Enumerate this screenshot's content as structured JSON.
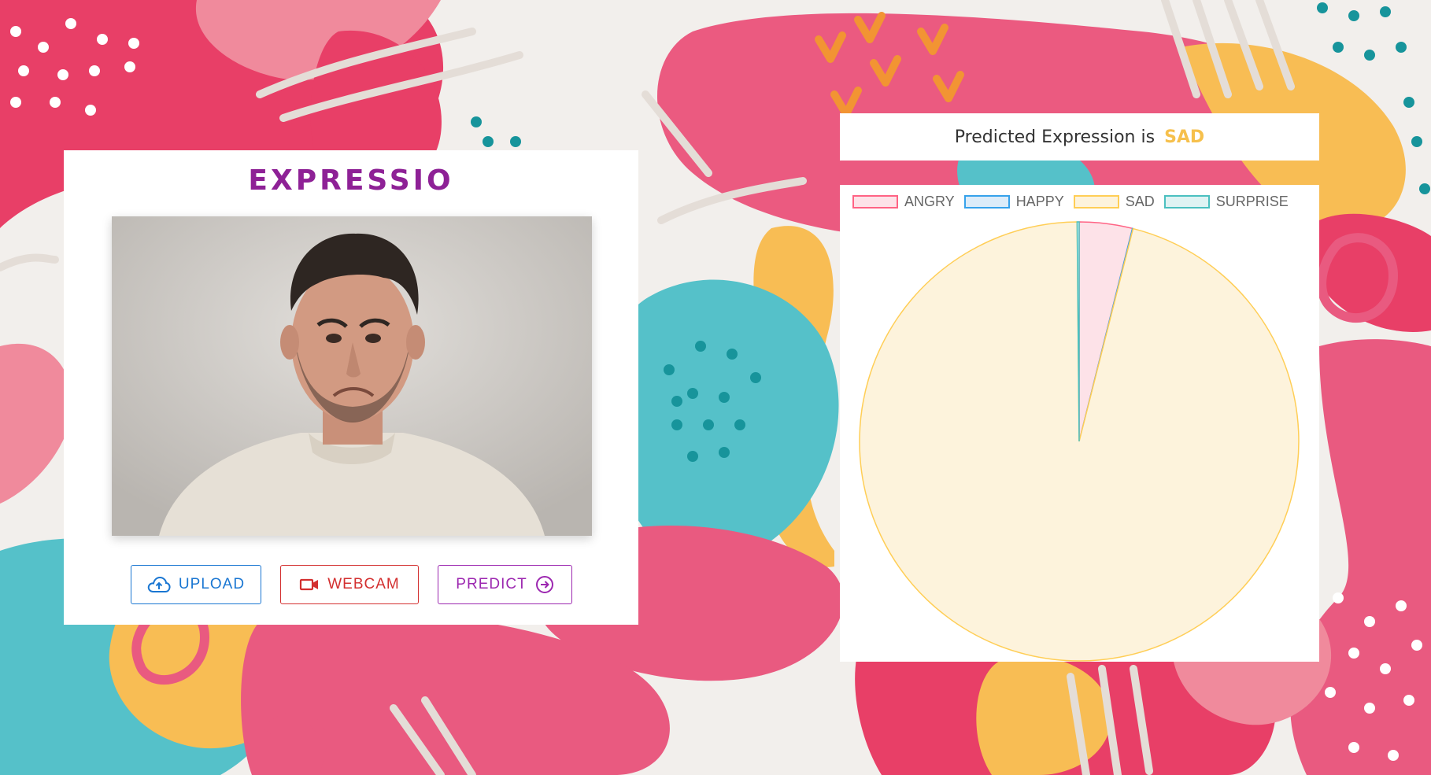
{
  "app": {
    "title": "EXPRESSIO"
  },
  "buttons": {
    "upload": {
      "label": "UPLOAD",
      "icon": "cloud-upload-icon"
    },
    "webcam": {
      "label": "WEBCAM",
      "icon": "videocam-icon"
    },
    "predict": {
      "label": "PREDICT",
      "icon": "arrow-circle-right-icon"
    }
  },
  "prediction": {
    "prefix": "Predicted Expression is",
    "value": "SAD"
  },
  "photo": {
    "subject": "sad-man-portrait"
  },
  "colors": {
    "title": "#8e2196",
    "upload": "#1976d2",
    "webcam": "#d32f2f",
    "predict": "#9c27b0",
    "prediction_value": "#f6c04c"
  },
  "chart_data": {
    "type": "pie",
    "legend_position": "top",
    "labels": [
      "ANGRY",
      "HAPPY",
      "SAD",
      "SURPRISE"
    ],
    "values": [
      3.9,
      0.05,
      95.9,
      0.15
    ],
    "background_colors": [
      "#fde2e8",
      "#dcecf9",
      "#fdf3dc",
      "#dff3f3"
    ],
    "border_colors": [
      "#ff6384",
      "#36a2eb",
      "#ffce56",
      "#4bc0c0"
    ]
  }
}
